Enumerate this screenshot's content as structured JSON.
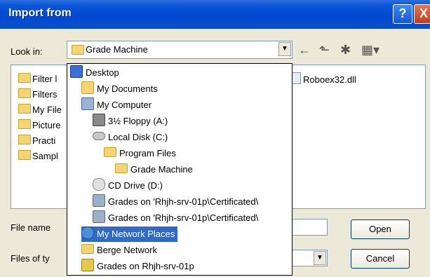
{
  "window": {
    "title": "Import from"
  },
  "title_buttons": {
    "help": "?",
    "close": "X"
  },
  "look_in": {
    "label": "Look in:",
    "value": "Grade Machine"
  },
  "toolbar": {
    "back": "←",
    "up": "⬑",
    "new_folder": "✱",
    "views": "▦▾"
  },
  "file_list": [
    {
      "label": "Filter l",
      "icon": "folder-icon"
    },
    {
      "label": "Filters",
      "icon": "folder-icon"
    },
    {
      "label": "My File",
      "icon": "folder-icon"
    },
    {
      "label": "Picture",
      "icon": "folder-icon"
    },
    {
      "label": "Practi",
      "icon": "folder-icon"
    },
    {
      "label": "Sampl",
      "icon": "folder-icon"
    }
  ],
  "file_list_right": {
    "label": "Roboex32.dll",
    "icon": "dll-file-icon"
  },
  "bottom": {
    "file_name_label": "File name",
    "files_of_type_label": "Files of ty",
    "open_button": "Open",
    "cancel_button": "Cancel"
  },
  "dropdown": {
    "items": [
      {
        "label": "Desktop",
        "icon": "desktop-icon"
      },
      {
        "label": "My Documents",
        "icon": "my-documents-icon"
      },
      {
        "label": "My Computer",
        "icon": "my-computer-icon"
      },
      {
        "label": "3½ Floppy (A:)",
        "icon": "floppy-drive-icon"
      },
      {
        "label": "Local Disk (C:)",
        "icon": "local-disk-icon"
      },
      {
        "label": "Program Files",
        "icon": "folder-icon"
      },
      {
        "label": "Grade Machine",
        "icon": "open-folder-icon"
      },
      {
        "label": "CD Drive (D:)",
        "icon": "cd-drive-icon"
      },
      {
        "label": "Grades on 'Rhjh-srv-01p\\Certificated\\",
        "icon": "network-share-icon"
      },
      {
        "label": "Grades on 'Rhjh-srv-01p\\Certificated\\",
        "icon": "network-share-icon"
      },
      {
        "label": "My Network Places",
        "icon": "network-places-icon",
        "selected": true
      },
      {
        "label": "Berge Network",
        "icon": "folder-icon"
      },
      {
        "label": "Grades on Rhjh-srv-01p",
        "icon": "network-drive-icon"
      }
    ]
  }
}
